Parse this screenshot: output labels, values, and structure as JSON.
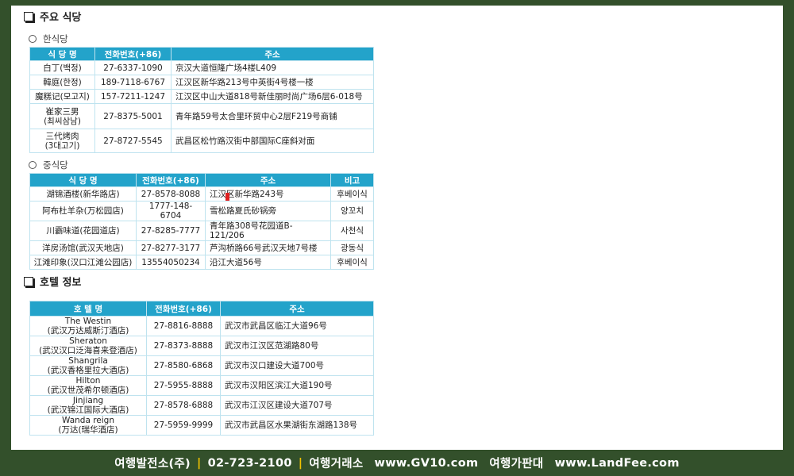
{
  "sections": {
    "restaurants_title": "주요 식당",
    "hotels_title": "호텔 정보"
  },
  "korean": {
    "title": "한식당",
    "headers": [
      "식 당 명",
      "전화번호(+86)",
      "주소"
    ],
    "rows": [
      {
        "name": "白丁(백정)",
        "phone": "27-6337-1090",
        "addr": "京汉大道恒隆广场4楼L409"
      },
      {
        "name": "韓庭(한정)",
        "phone": "189-7118-6767",
        "addr": "江汉区新华路213号中英街4号楼一楼"
      },
      {
        "name": "魔糕记(모고지)",
        "phone": "157-7211-1247",
        "addr": "江汉区中山大道818号新佳丽时尚广场6层6-018号"
      },
      {
        "name": "崔家三男",
        "name2": "(최씨삼남)",
        "phone": "27-8375-5001",
        "addr": "青年路59号太合里环贸中心2层F219号商铺"
      },
      {
        "name": "三代烤肉",
        "name2": "(3대고기)",
        "phone": "27-8727-5545",
        "addr": "武昌区松竹路汉街中部国际C座斜对面"
      }
    ]
  },
  "chinese": {
    "title": "중식당",
    "headers": [
      "식 당 명",
      "전화번호(+86)",
      "주소",
      "비고"
    ],
    "rows": [
      {
        "name": "湖锦酒楼(新华路店)",
        "phone": "27-8578-8088",
        "addr": "江汉区新华路243号",
        "note": "후베이식"
      },
      {
        "name": "阿布杜羊杂(万松园店)",
        "phone": "1777-148-6704",
        "addr": "雪松路夏氏砂锅旁",
        "note": "양꼬치"
      },
      {
        "name": "川霸味道(花园道店)",
        "phone": "27-8285-7777",
        "addr": "青年路308号花园道B-121/206",
        "note": "사천식"
      },
      {
        "name": "洋房汤馆(武汉天地店)",
        "phone": "27-8277-3177",
        "addr": "芦沟桥路66号武汉天地7号楼",
        "note": "광동식"
      },
      {
        "name": "江滩印象(汉口江滩公园店)",
        "phone": "13554050234",
        "addr": "沿江大道56号",
        "note": "후베이식"
      }
    ]
  },
  "hotels": {
    "headers": [
      "호 텔 명",
      "전화번호(+86)",
      "주소"
    ],
    "rows": [
      {
        "name": "The Westin",
        "name2": "(武汉万达威斯汀酒店)",
        "phone": "27-8816-8888",
        "addr": "武汉市武昌区临江大道96号"
      },
      {
        "name": "Sheraton",
        "name2": "(武汉汉口泛海喜来登酒店)",
        "phone": "27-8373-8888",
        "addr": "武汉市江汉区范湖路80号"
      },
      {
        "name": "Shangrila",
        "name2": "(武汉香格里拉大酒店)",
        "phone": "27-8580-6868",
        "addr": "武汉市汉口建设大道700号"
      },
      {
        "name": "Hilton",
        "name2": "(武汉世茂希尔顿酒店)",
        "phone": "27-5955-8888",
        "addr": "武汉市汉阳区滨江大道190号"
      },
      {
        "name": "Jinjiang",
        "name2": "(武汉锦江国际大酒店)",
        "phone": "27-8578-6888",
        "addr": "武汉市江汉区建设大道707号"
      },
      {
        "name": "Wanda reign",
        "name2": "(万达(瑞华酒店)",
        "phone": "27-5959-9999",
        "addr": "武汉市武昌区水果湖街东湖路138号"
      }
    ]
  },
  "footer": {
    "company": "여행발전소(주)",
    "phone": "02-723-2100",
    "label1": "여행거래소",
    "url1": "www.GV10.com",
    "label2": "여행가판대",
    "url2": "www.LandFee.com",
    "sep": "|"
  },
  "colors": {
    "header_bg": "#23a3ca",
    "frame_bg": "#33502b",
    "separator": "#f2c200"
  }
}
